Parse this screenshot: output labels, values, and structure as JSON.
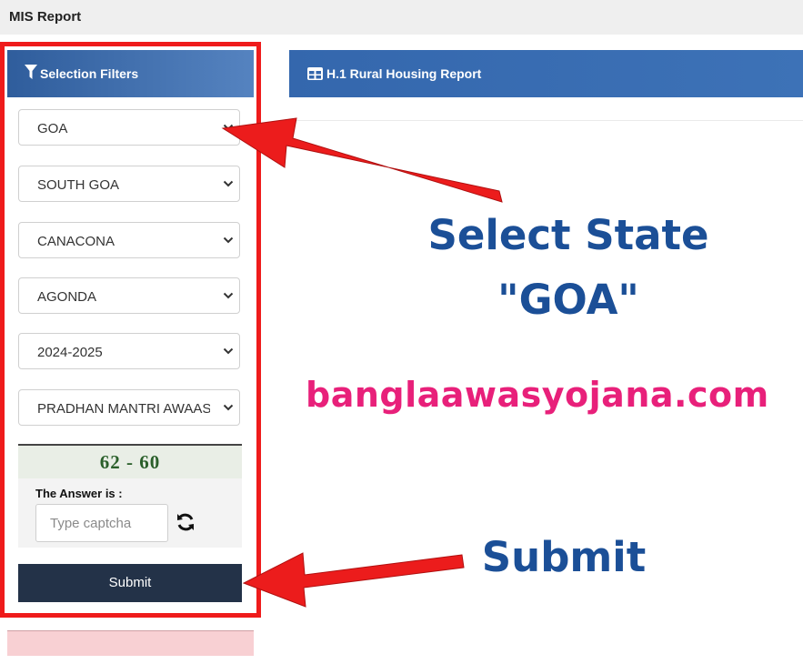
{
  "app": {
    "title": "MIS Report"
  },
  "filters": {
    "header": "Selection Filters",
    "selects": [
      {
        "value": "GOA"
      },
      {
        "value": "SOUTH GOA"
      },
      {
        "value": "CANACONA"
      },
      {
        "value": "AGONDA"
      },
      {
        "value": "2024-2025"
      },
      {
        "value": "PRADHAN MANTRI AWAAS"
      }
    ],
    "captcha": {
      "code": "62 - 60",
      "answer_label": "The Answer is :",
      "placeholder": "Type captcha"
    },
    "submit_label": "Submit"
  },
  "report": {
    "title": "H.1 Rural Housing Report"
  },
  "annotations": {
    "select_state_line1": "Select State",
    "select_state_line2": "\"GOA\"",
    "watermark": "banglaawasyojana.com",
    "submit": "Submit"
  },
  "colors": {
    "header_blue": "#3467ad",
    "highlight_red": "#ef1b1b",
    "annotation_blue": "#1b4f97",
    "watermark_pink": "#e8207a",
    "submit_dark": "#233248"
  }
}
